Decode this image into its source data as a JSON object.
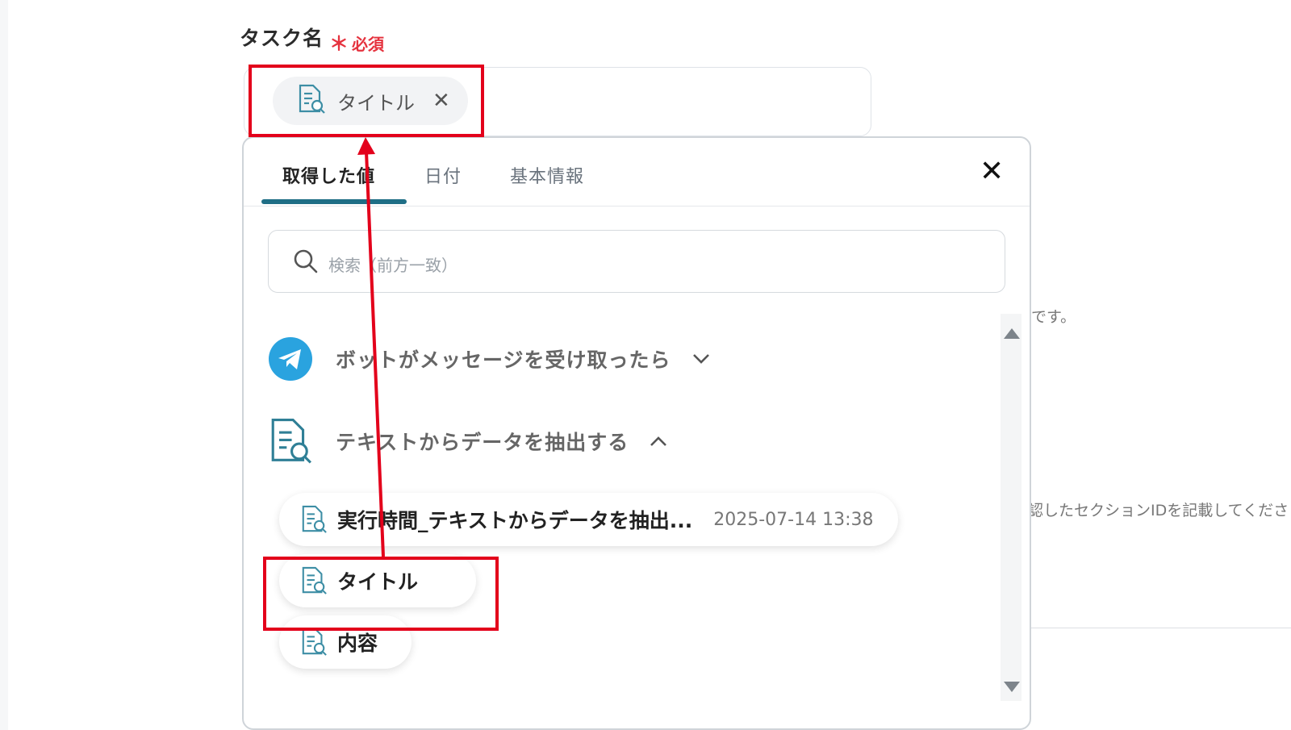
{
  "field": {
    "label": "タスク名",
    "required_star": "＊",
    "required_text": "必須"
  },
  "selected_chip": {
    "icon": "document-search-icon",
    "label": "タイトル",
    "remove_icon": "close-icon"
  },
  "background_text": {
    "line1": "です。",
    "line2": "認したセクションIDを記載してくださ"
  },
  "popup": {
    "tabs": [
      {
        "label": "取得した値",
        "active": true
      },
      {
        "label": "日付",
        "active": false
      },
      {
        "label": "基本情報",
        "active": false
      }
    ],
    "close_icon": "close-icon",
    "search": {
      "placeholder": "検索（前方一致）",
      "icon": "search-icon"
    },
    "groups": [
      {
        "name": "ボットがメッセージを受け取ったら",
        "icon": "telegram-icon",
        "expanded": false
      },
      {
        "name": "テキストからデータを抽出する",
        "icon": "document-search-icon",
        "expanded": true,
        "items": [
          {
            "label": "実行時間_テキストからデータを抽出...",
            "value": "2025-07-14 13:38"
          },
          {
            "label": "タイトル"
          },
          {
            "label": "内容"
          }
        ]
      }
    ]
  },
  "colors": {
    "accent": "#1f6e86",
    "required": "#e5323e",
    "highlight": "#e3001b",
    "telegram": "#2aa3df"
  }
}
